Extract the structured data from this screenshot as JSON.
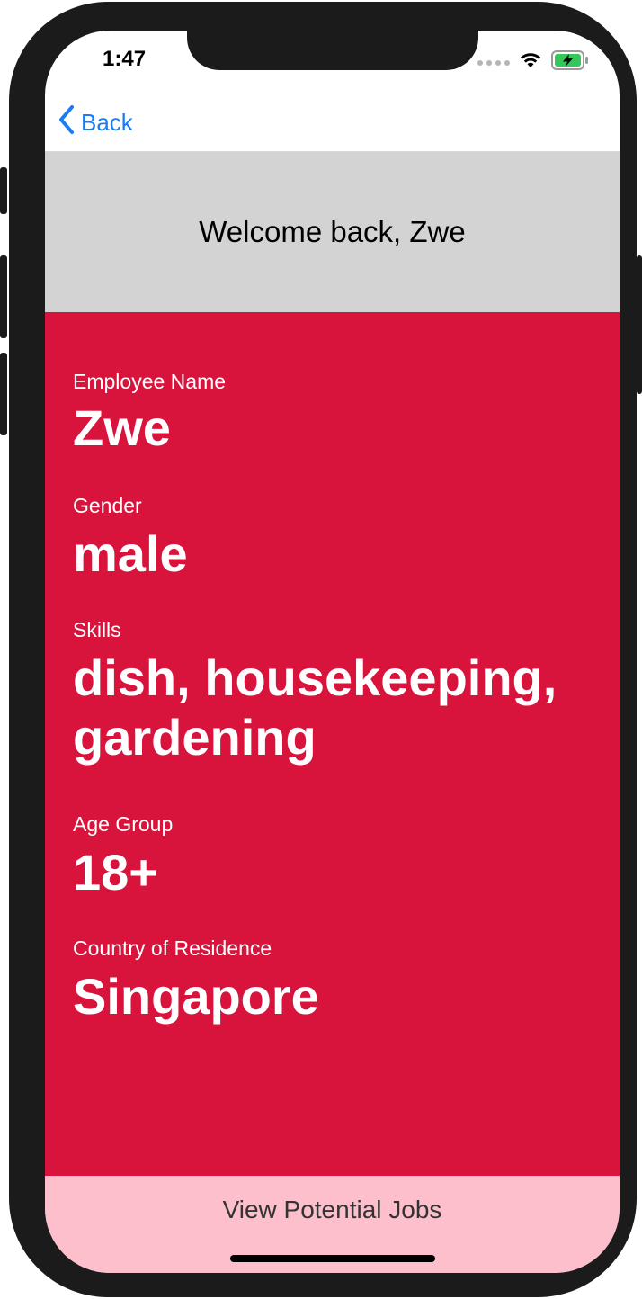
{
  "status_bar": {
    "time": "1:47",
    "icons": [
      "cellular-dots-icon",
      "wifi-icon",
      "battery-charging-icon"
    ],
    "battery_color": "#34c759"
  },
  "nav": {
    "back_label": "Back",
    "accent_color": "#1a7cf5"
  },
  "welcome": {
    "text": "Welcome back, Zwe"
  },
  "profile": {
    "background_color": "#d9143c",
    "fields": [
      {
        "label": "Employee Name",
        "value": "Zwe"
      },
      {
        "label": "Gender",
        "value": "male"
      },
      {
        "label": "Skills",
        "value": "dish, housekeeping, gardening"
      },
      {
        "label": "Age Group",
        "value": "18+"
      },
      {
        "label": "Country of Residence",
        "value": "Singapore"
      }
    ]
  },
  "bottom_button": {
    "label": "View Potential Jobs",
    "background_color": "#fcbfcb"
  }
}
